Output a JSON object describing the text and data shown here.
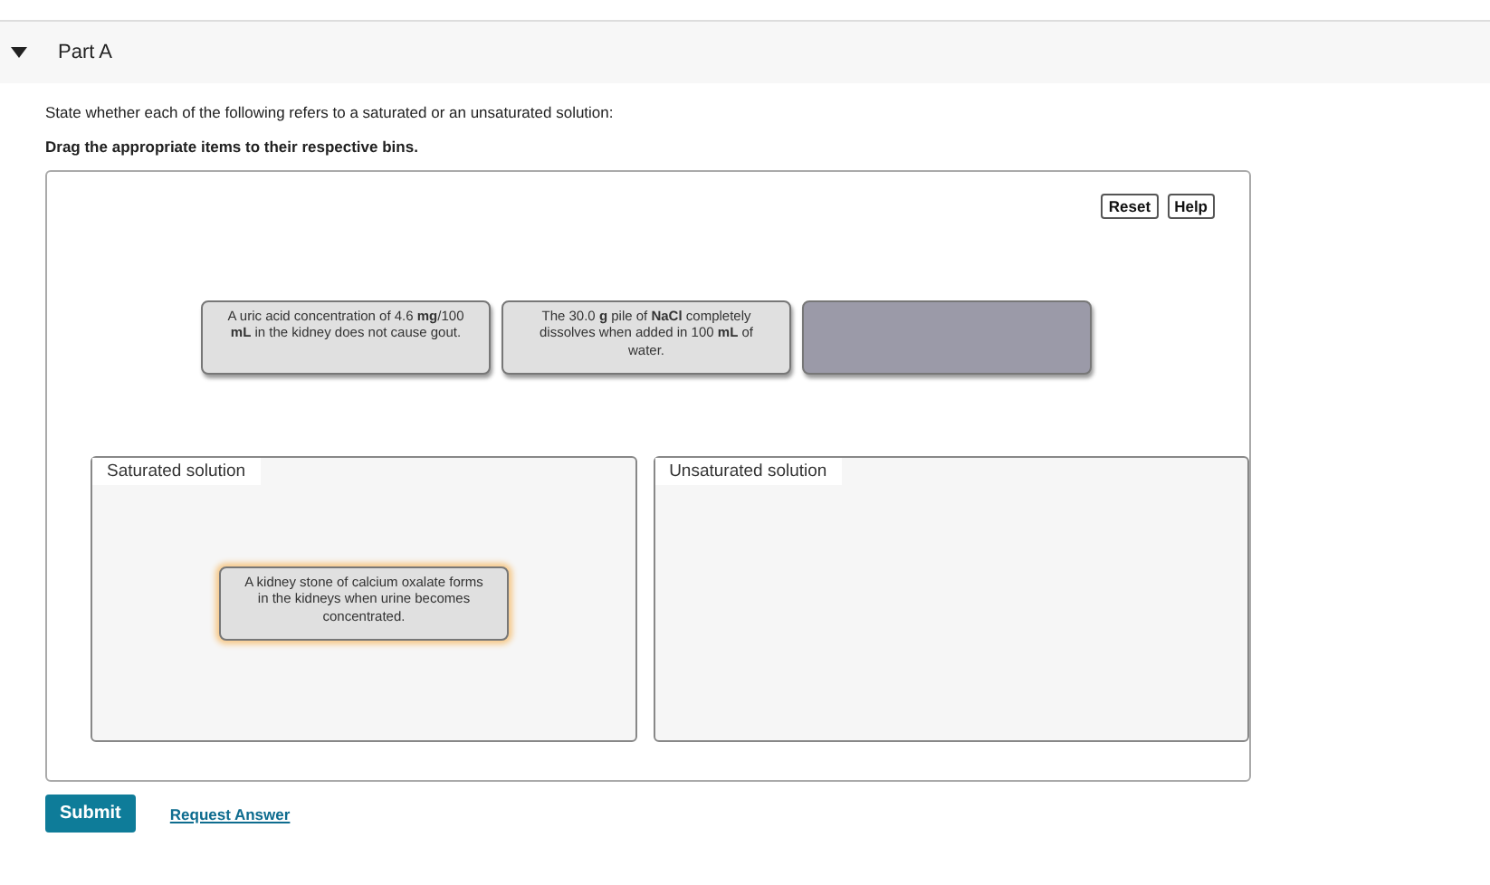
{
  "part": {
    "title": "Part A",
    "expanded": true
  },
  "instruction": "State whether each of the following refers to a saturated or an unsaturated solution:",
  "directive": "Drag the appropriate items to their respective bins.",
  "toolbar": [
    "Reset",
    "Help"
  ],
  "pool": [
    {
      "kind": "card",
      "text": "A uric acid concentration of 4.6 **mg**/100 **mL** in the kidney does not cause gout."
    },
    {
      "kind": "card",
      "text": "The 30.0 **g** pile of **NaCl** completely dissolves when added in 100 **mL** of water."
    },
    {
      "kind": "empty"
    }
  ],
  "bins": [
    {
      "label": "Saturated solution",
      "items": [
        {
          "text": "A kidney stone of calcium oxalate forms in the kidneys when urine becomes concentrated.",
          "highlighted": true
        }
      ]
    },
    {
      "label": "Unsaturated solution"
    }
  ],
  "submit": "Submit",
  "request_answer": "Request Answer"
}
